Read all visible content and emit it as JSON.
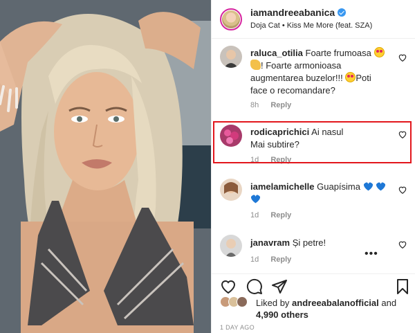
{
  "post": {
    "username": "iamandreeabanica",
    "music": "Doja Cat • Kiss Me More (feat. SZA)"
  },
  "comments": [
    {
      "user": "raluca_otilia",
      "text_parts": [
        "Foarte frumoasa",
        "! Foarte armonioasa augmentarea buzelor!!! ",
        "Poti face o recomandare?"
      ],
      "time": "8h",
      "reply": "Reply"
    },
    {
      "user": "rodicaprichici",
      "text": "Ai nasul Mai subtire?",
      "time": "1d",
      "reply": "Reply"
    },
    {
      "user": "iamelamichelle",
      "text": "Guapísima",
      "time": "1d",
      "reply": "Reply"
    },
    {
      "user": "janavram",
      "text": "Și petre!",
      "time": "1d",
      "reply": "Reply"
    }
  ],
  "likes": {
    "prefix": "Liked by",
    "user": "andreeabalanofficial",
    "and": "and",
    "others": "4,990 others"
  },
  "timestamp": "1 DAY AGO",
  "icons": {
    "like": "heart-outline-icon",
    "comment": "comment-bubble-icon",
    "share": "paper-plane-icon",
    "save": "bookmark-icon",
    "more": "more-dots-icon",
    "verified": "verified-badge-icon"
  },
  "colors": {
    "highlight_box": "#e2161c",
    "verified": "#3897f0",
    "meta_gray": "#8e8e8e",
    "emoji_blue_heart": "#1e78d6"
  }
}
